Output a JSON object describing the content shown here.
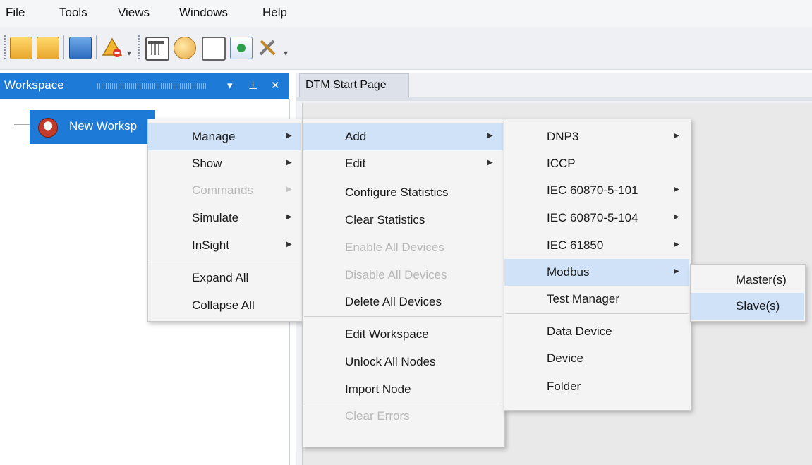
{
  "menubar": {
    "items": [
      "File",
      "Tools",
      "Views",
      "Windows",
      "Help"
    ]
  },
  "toolbar": {
    "icons": [
      "open-folder-icon",
      "open-folder-arrow-icon",
      "save-icon",
      "alarm-warning-icon",
      "table-icon",
      "palette-icon",
      "clipboard-icon",
      "document-icon",
      "tools-icon"
    ]
  },
  "workspace": {
    "title": "Workspace",
    "pin_glyph": "▾",
    "pin2_glyph": "⊥",
    "close_glyph": "✕",
    "node_label": "New Worksp"
  },
  "document": {
    "tab_label": "DTM Start Page"
  },
  "menu1": {
    "items": [
      {
        "label": "Manage",
        "submenu": true,
        "highlight": true,
        "disabled": false
      },
      {
        "label": "Show",
        "submenu": true,
        "highlight": false,
        "disabled": false
      },
      {
        "label": "Commands",
        "submenu": true,
        "highlight": false,
        "disabled": true
      },
      {
        "label": "Simulate",
        "submenu": true,
        "highlight": false,
        "disabled": false
      },
      {
        "label": "InSight",
        "submenu": true,
        "highlight": false,
        "disabled": false
      },
      {
        "label": "Expand All",
        "submenu": false,
        "highlight": false,
        "disabled": false
      },
      {
        "label": "Collapse All",
        "submenu": false,
        "highlight": false,
        "disabled": false
      }
    ]
  },
  "menu2": {
    "items": [
      {
        "label": "Add",
        "submenu": true,
        "highlight": true,
        "disabled": false
      },
      {
        "label": "Edit",
        "submenu": true,
        "highlight": false,
        "disabled": false
      },
      {
        "label": "Configure Statistics",
        "submenu": false,
        "highlight": false,
        "disabled": false
      },
      {
        "label": "Clear Statistics",
        "submenu": false,
        "highlight": false,
        "disabled": false
      },
      {
        "label": "Enable All Devices",
        "submenu": false,
        "highlight": false,
        "disabled": true
      },
      {
        "label": "Disable All Devices",
        "submenu": false,
        "highlight": false,
        "disabled": true
      },
      {
        "label": "Delete All Devices",
        "submenu": false,
        "highlight": false,
        "disabled": false
      },
      {
        "label": "Edit Workspace",
        "submenu": false,
        "highlight": false,
        "disabled": false
      },
      {
        "label": "Unlock All Nodes",
        "submenu": false,
        "highlight": false,
        "disabled": false
      },
      {
        "label": "Import Node",
        "submenu": false,
        "highlight": false,
        "disabled": false
      },
      {
        "label": "Clear Errors",
        "submenu": false,
        "highlight": false,
        "disabled": true
      }
    ]
  },
  "menu3": {
    "items": [
      {
        "label": "DNP3",
        "submenu": true,
        "highlight": false,
        "disabled": false
      },
      {
        "label": "ICCP",
        "submenu": false,
        "highlight": false,
        "disabled": false
      },
      {
        "label": "IEC 60870-5-101",
        "submenu": true,
        "highlight": false,
        "disabled": false
      },
      {
        "label": "IEC 60870-5-104",
        "submenu": true,
        "highlight": false,
        "disabled": false
      },
      {
        "label": "IEC 61850",
        "submenu": true,
        "highlight": false,
        "disabled": false
      },
      {
        "label": "Modbus",
        "submenu": true,
        "highlight": true,
        "disabled": false
      },
      {
        "label": "Test Manager",
        "submenu": false,
        "highlight": false,
        "disabled": false
      },
      {
        "label": "Data Device",
        "submenu": false,
        "highlight": false,
        "disabled": false
      },
      {
        "label": "Device",
        "submenu": false,
        "highlight": false,
        "disabled": false
      },
      {
        "label": "Folder",
        "submenu": false,
        "highlight": false,
        "disabled": false
      }
    ]
  },
  "menu4": {
    "items": [
      {
        "label": "Master(s)",
        "submenu": false,
        "highlight": false,
        "disabled": false
      },
      {
        "label": "Slave(s)",
        "submenu": false,
        "highlight": true,
        "disabled": false
      }
    ]
  },
  "colors": {
    "accent": "#1d7ad6",
    "menu_highlight": "#cfe2f7",
    "menu_bg": "#f4f4f4",
    "disabled_text": "#b8b8b8"
  }
}
